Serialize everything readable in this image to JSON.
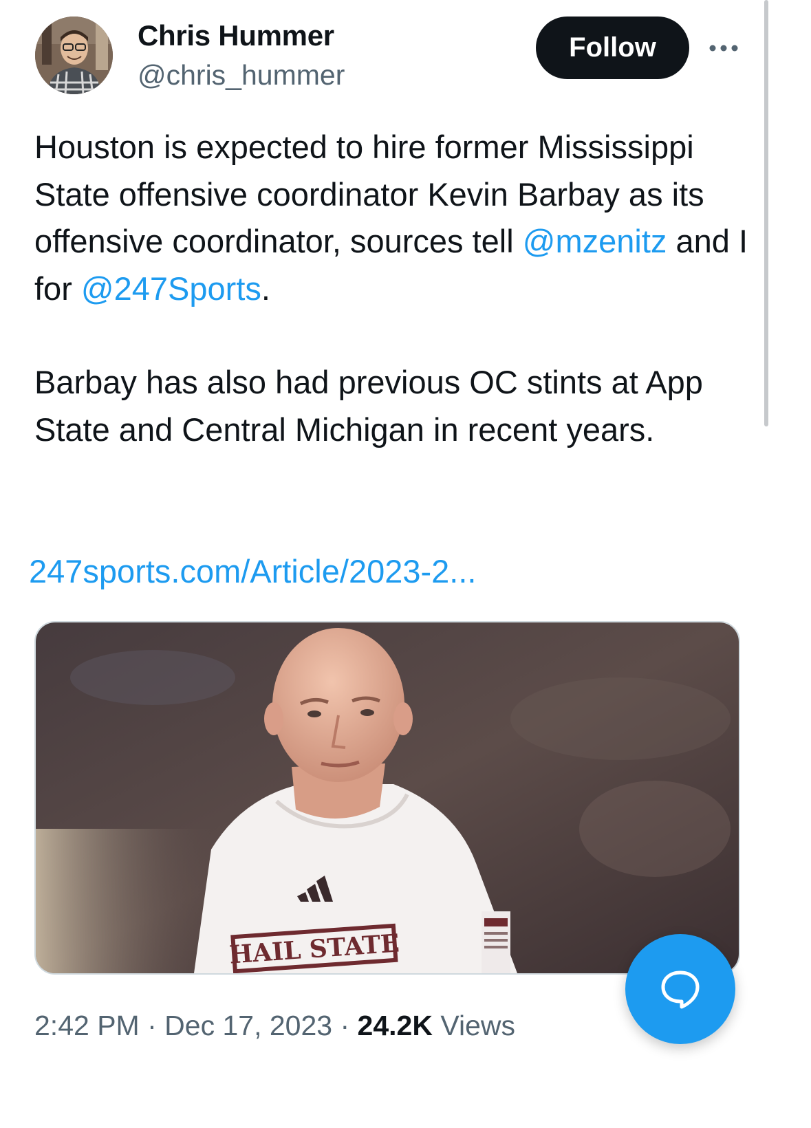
{
  "author": {
    "name": "Chris Hummer",
    "handle": "@chris_hummer"
  },
  "actions": {
    "follow_label": "Follow"
  },
  "tweet": {
    "p1": {
      "t1": "Houston is expected to hire former Mississippi State offensive coordinator Kevin Barbay as its offensive coordinator, sources tell ",
      "mention1": "@mzenitz",
      "t2": " and I for ",
      "mention2": "@247Sports",
      "t3": "."
    },
    "p2": "Barbay has also had previous OC stints at App State and Central Michigan in recent years.",
    "link": "247sports.com/Article/2023-2..."
  },
  "media": {
    "shirt_text": "HAIL STATE"
  },
  "meta": {
    "time": "2:42 PM",
    "separator": "·",
    "date": "Dec 17, 2023",
    "views_count": "24.2K",
    "views_label": "Views"
  },
  "icons": {
    "more": "more-horizontal-icon",
    "reply": "reply-bubble-icon",
    "avatar": "profile-photo",
    "media": "photo"
  },
  "colors": {
    "link": "#1d9bf0",
    "secondary_text": "#536471",
    "primary_text": "#0f1419",
    "follow_bg": "#0f1419",
    "fab_bg": "#1d9bf0"
  }
}
